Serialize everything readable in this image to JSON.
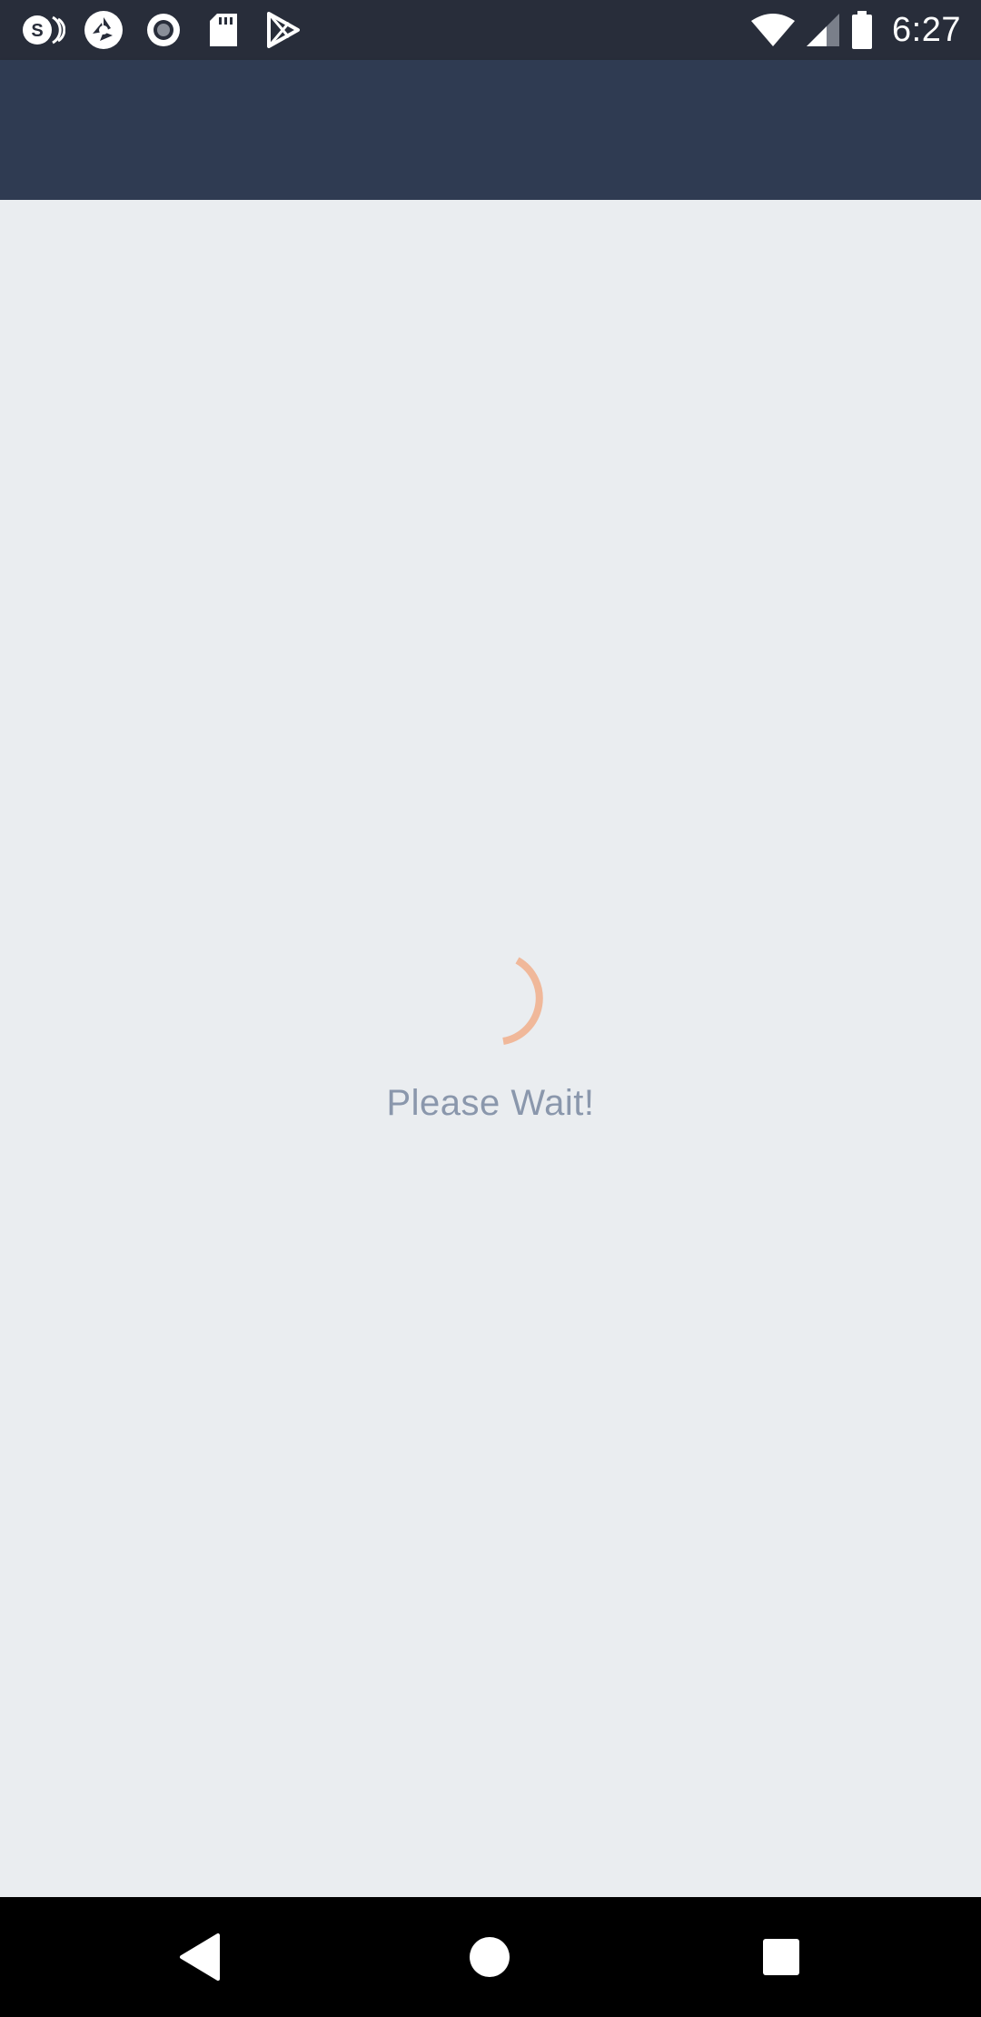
{
  "status_bar": {
    "time": "6:27",
    "notification_icons": [
      "s-sync-icon",
      "shutter-icon",
      "record-icon",
      "sd-card-icon",
      "play-store-icon"
    ],
    "system_icons": [
      "wifi-icon",
      "signal-icon",
      "battery-icon"
    ]
  },
  "app_bar": {
    "title": ""
  },
  "loading": {
    "message": "Please Wait!",
    "spinner_color": "#f0b89a"
  },
  "colors": {
    "status_bar": "#282d3a",
    "app_bar": "#2f3b52",
    "background": "#eaedf0",
    "message_text": "#8a97ac",
    "nav_bar": "#000000"
  },
  "nav_bar": {
    "buttons": [
      "back",
      "home",
      "recents"
    ]
  }
}
